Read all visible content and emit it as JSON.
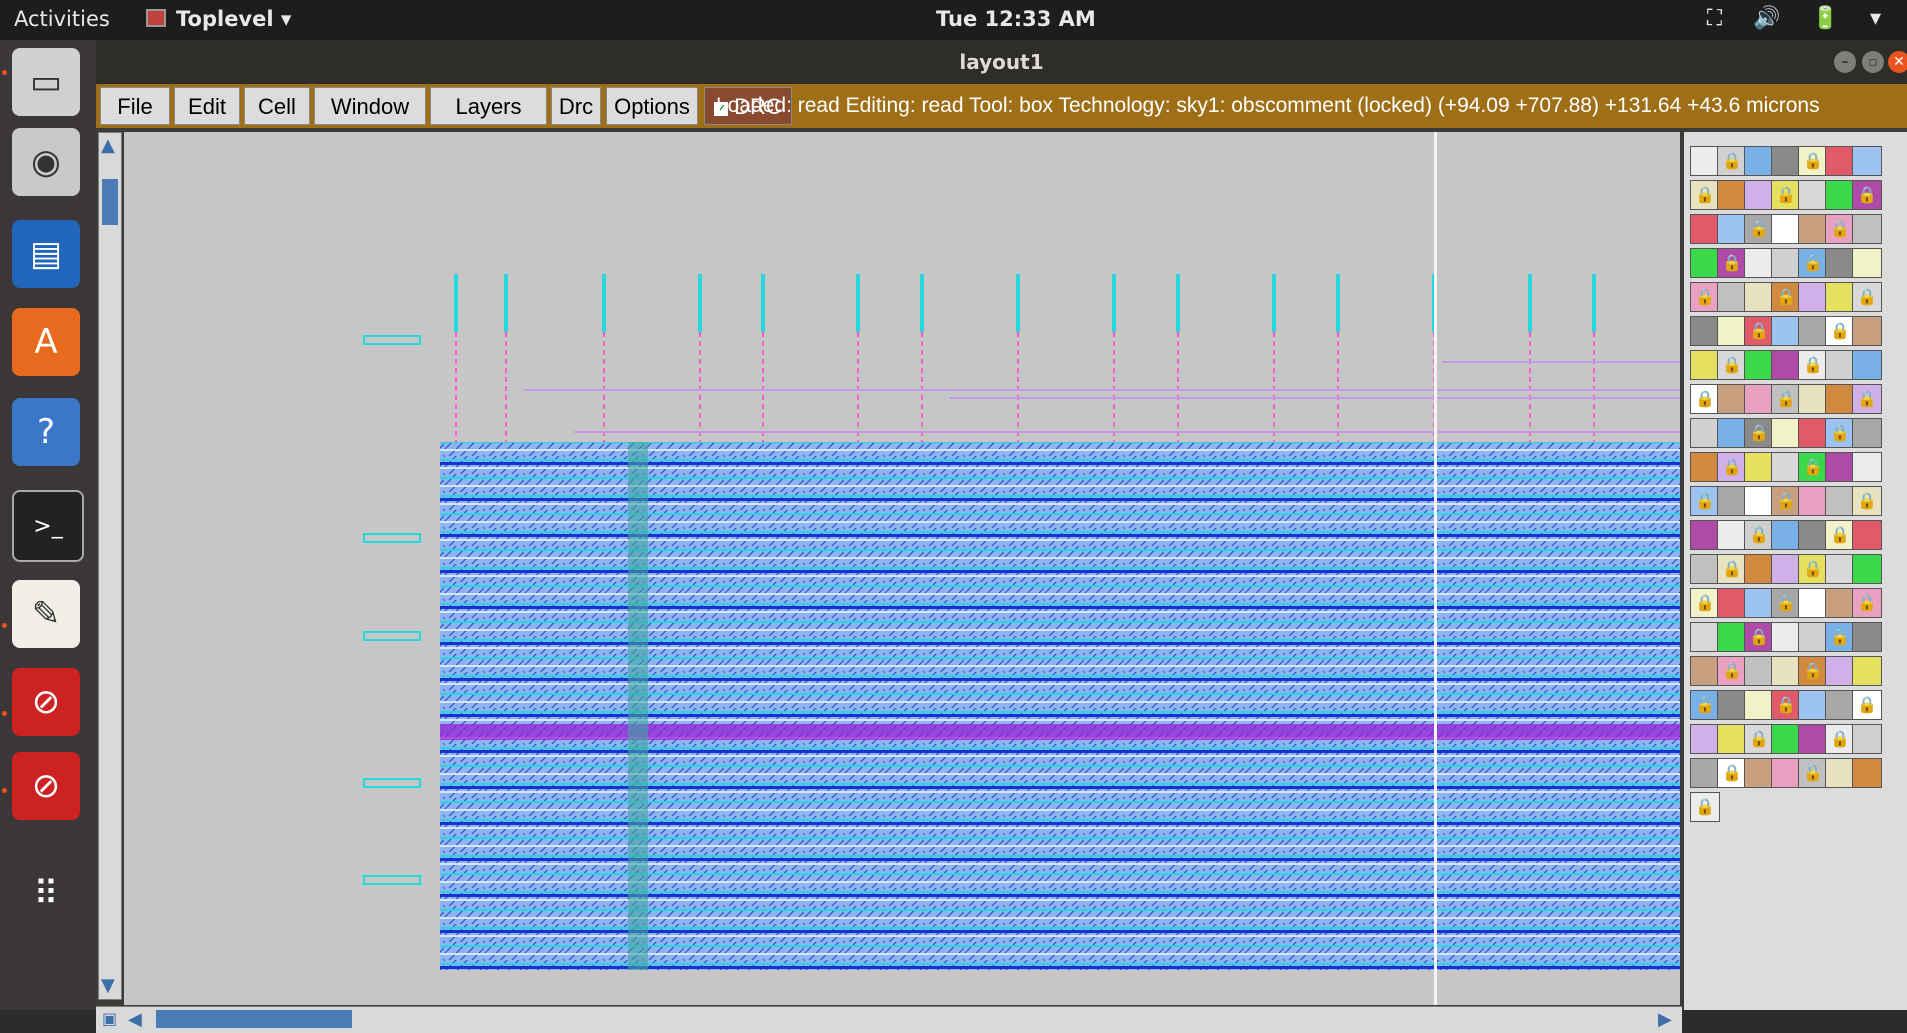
{
  "topbar": {
    "activities": "Activities",
    "app_name": "Toplevel",
    "app_arrow": "▾",
    "clock": "Tue 12:33 AM",
    "tray_icons": [
      "network-icon",
      "volume-icon",
      "battery-icon",
      "system-menu-icon"
    ],
    "tray_text": "⛶ 🔊 🔋 ▾"
  },
  "window": {
    "title": "layout1",
    "menus": [
      "File",
      "Edit",
      "Cell",
      "Window",
      "Layers",
      "Drc",
      "Options"
    ],
    "drc_toggle": {
      "label": "DRC",
      "checked": true
    },
    "status": "Loaded: read Editing: read Tool: box  Technology: sky1: obscomment (locked)   (+94.09 +707.88) +131.64 +43.6 microns"
  },
  "dock": [
    {
      "name": "drive-icon",
      "glyph": "▭"
    },
    {
      "name": "rhythmbox-icon",
      "glyph": "◉"
    },
    {
      "name": "writer-icon",
      "glyph": "▤"
    },
    {
      "name": "software-center-icon",
      "glyph": "A"
    },
    {
      "name": "help-icon",
      "glyph": "?"
    },
    {
      "name": "terminal-icon",
      "glyph": ">_"
    },
    {
      "name": "text-editor-icon",
      "glyph": "✎"
    },
    {
      "name": "blocked-app-icon",
      "glyph": "⊘"
    },
    {
      "name": "blocked-app-icon",
      "glyph": "⊘"
    },
    {
      "name": "show-apps-icon",
      "glyph": "⠿"
    }
  ],
  "colors": {
    "menubar_accent": "#9e6f16",
    "canvas_bg": "#c6c6c6",
    "layer_blue": "#3a7bd5",
    "layer_cyan": "#25d8e0",
    "layer_pink": "#ff5ec8"
  }
}
